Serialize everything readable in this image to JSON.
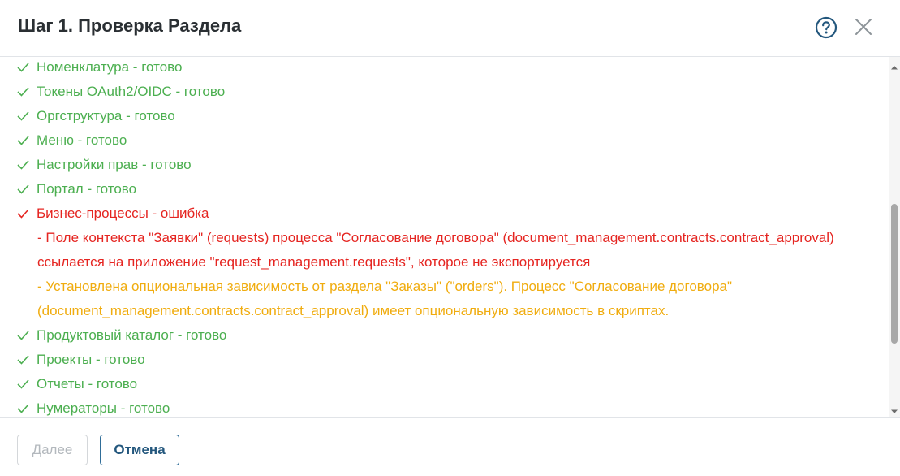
{
  "dialog": {
    "title": "Шаг 1. Проверка Раздела",
    "help_icon": "question-circle-icon",
    "close_icon": "close-x-icon"
  },
  "colors": {
    "ok": "#4caf50",
    "error": "#e52521",
    "warning": "#f0ac0f",
    "accent": "#23577d"
  },
  "checks": [
    {
      "label": "Номенклатура - готово",
      "status": "ok"
    },
    {
      "label": "Токены OAuth2/OIDC - готово",
      "status": "ok"
    },
    {
      "label": "Оргструктура - готово",
      "status": "ok"
    },
    {
      "label": "Меню - готово",
      "status": "ok"
    },
    {
      "label": "Настройки прав - готово",
      "status": "ok"
    },
    {
      "label": "Портал - готово",
      "status": "ok"
    },
    {
      "label": "Бизнес-процессы - ошибка",
      "status": "error"
    },
    {
      "label": "Продуктовый каталог - готово",
      "status": "ok"
    },
    {
      "label": "Проекты - готово",
      "status": "ok"
    },
    {
      "label": "Отчеты - готово",
      "status": "ok"
    },
    {
      "label": "Нумераторы - готово",
      "status": "ok"
    }
  ],
  "messages": {
    "error_detail": "- Поле контекста \"Заявки\" (requests) процесса \"Согласование договора\" (document_management.contracts.contract_approval) ссылается на приложение \"request_management.requests\", которое не экспортируется",
    "warning_detail": "- Установлена опциональная зависимость от раздела \"Заказы\" (\"orders\"). Процесс \"Согласование договора\" (document_management.contracts.contract_approval) имеет опциональную зависимость в скриптах."
  },
  "footer": {
    "next_label": "Далее",
    "cancel_label": "Отмена"
  }
}
